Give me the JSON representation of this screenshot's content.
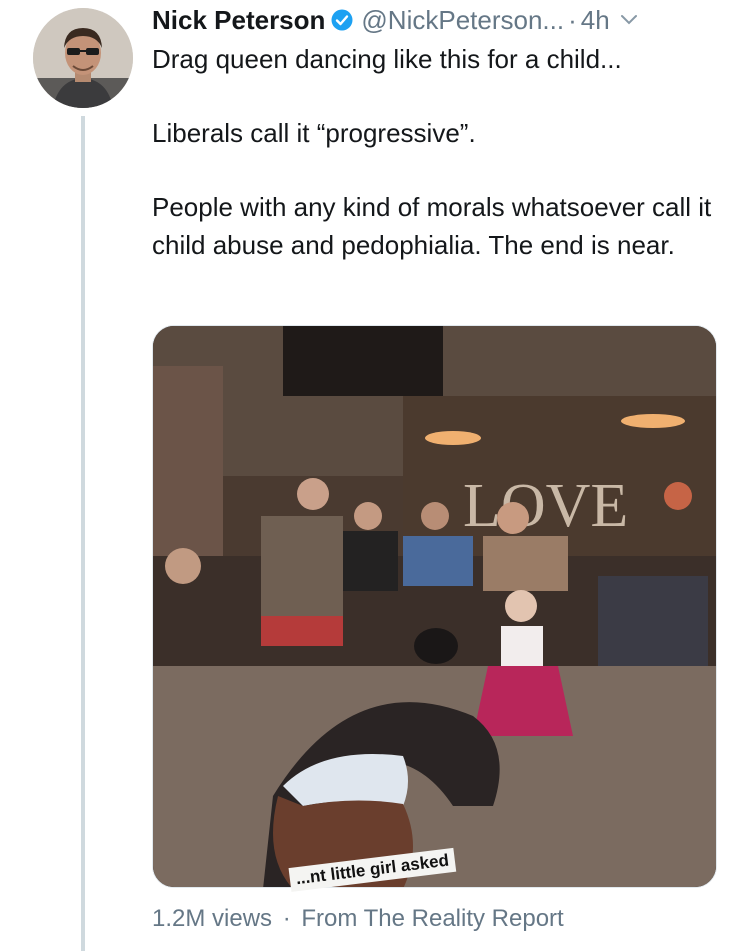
{
  "tweet": {
    "author_name": "Nick Peterson",
    "handle": "@NickPeterson...",
    "separator": "·",
    "time": "4h",
    "verified_icon": "verified-badge-icon",
    "menu_icon": "chevron-down-icon",
    "paragraphs": [
      "Drag queen dancing like this for a child...",
      "Liberals call it “progressive”.",
      "People with any kind of morals whatsoever call it child abuse and pedophialia. The end is near."
    ],
    "media": {
      "sign_text": "LOVE",
      "caption": "...nt little girl asked"
    },
    "views": "1.2M views",
    "footer_separator": "·",
    "source": "From The Reality Report"
  },
  "colors": {
    "verified_blue": "#1da1f2",
    "secondary_text": "#657786",
    "thread_line": "#cfd9de"
  }
}
